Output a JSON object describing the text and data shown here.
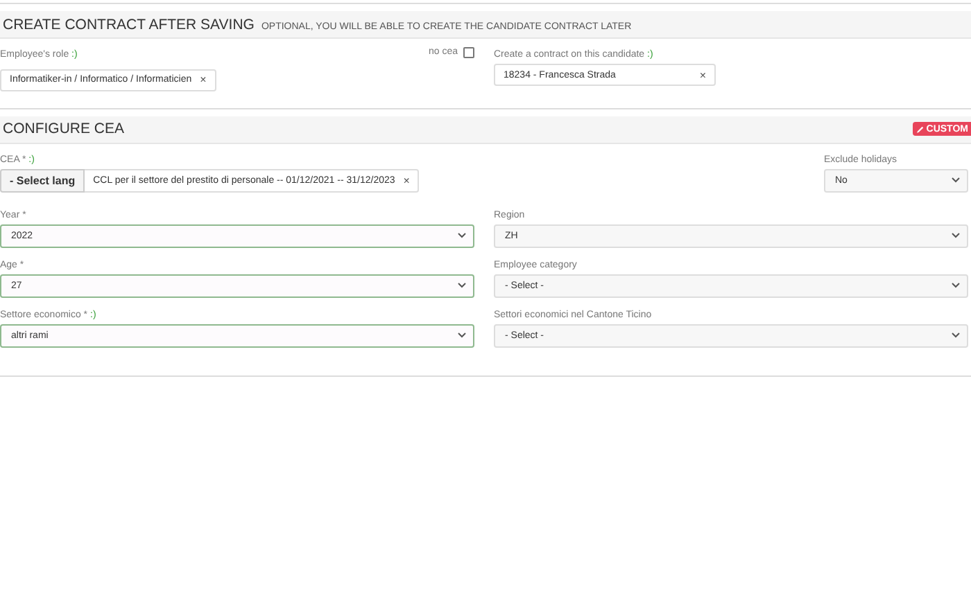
{
  "contract_section": {
    "title": "CREATE CONTRACT AFTER SAVING",
    "subtitle": "OPTIONAL, YOU WILL BE ABLE TO CREATE THE CANDIDATE CONTRACT LATER",
    "role": {
      "label": "Employee's role",
      "hint": ":)",
      "value": "Informatiker-in / Informatico / Informaticien",
      "remove": "×"
    },
    "no_cea": {
      "label": "no cea",
      "checked": false
    },
    "candidate": {
      "label": "Create a contract on this candidate",
      "hint": ":)",
      "value": "18234 - Francesca Strada",
      "remove": "×"
    }
  },
  "cea_section": {
    "title": "CONFIGURE CEA",
    "custom_button": "CUSTOM",
    "cea": {
      "label": "CEA *",
      "hint": ":)",
      "lang_button": "- Select lang",
      "value": "CCL per il settore del prestito di personale -- 01/12/2021 -- 31/12/2023",
      "remove": "×"
    },
    "exclude_holidays": {
      "label": "Exclude holidays",
      "value": "No"
    },
    "left_fields": [
      {
        "label": "Year *",
        "value": "2022",
        "valid": true
      },
      {
        "label": "Age *",
        "value": "27",
        "valid": true
      },
      {
        "label": "Settore economico *",
        "hint": ":)",
        "value": "altri rami",
        "valid": true
      }
    ],
    "right_fields": [
      {
        "label": "Region",
        "value": "ZH",
        "valid": false
      },
      {
        "label": "Employee category",
        "value": "- Select -",
        "valid": false
      },
      {
        "label": "Settori economici nel Cantone Ticino",
        "value": "- Select -",
        "valid": false
      }
    ]
  }
}
